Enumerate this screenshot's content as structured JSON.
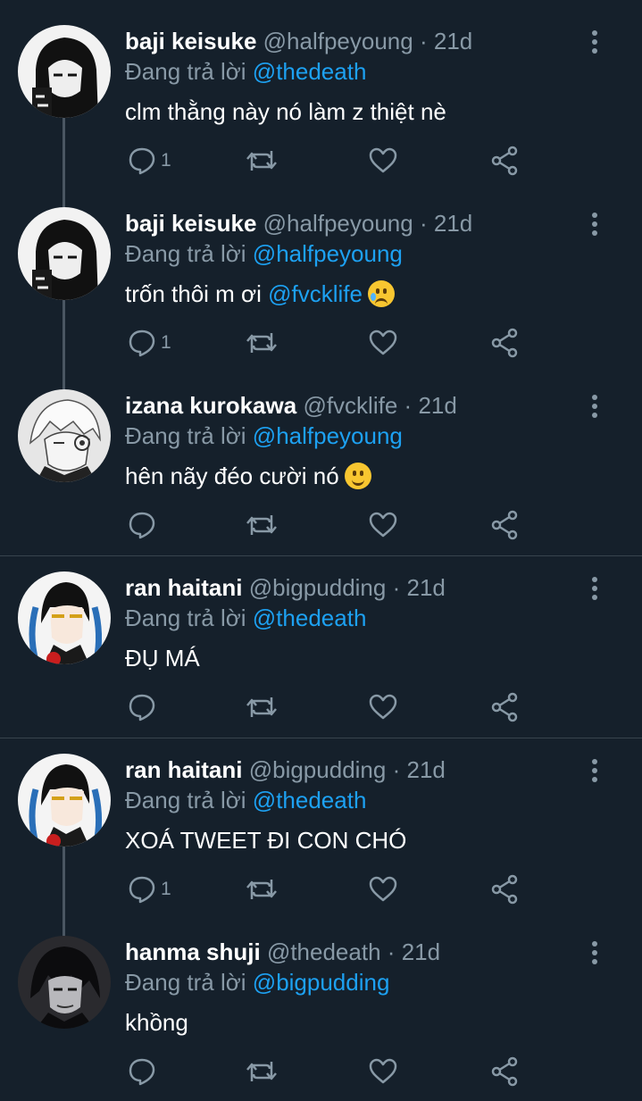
{
  "reply_prefix": "Đang trả lời",
  "separator": "·",
  "tweets": [
    {
      "name": "baji keisuke",
      "handle": "@halfpeyoung",
      "time": "21d",
      "reply_to": "@thedeath",
      "text": "clm thằng này nó làm z thiệt nè",
      "mention": "",
      "emoji": "",
      "reply_count": "1",
      "avatar": "baji-avatar"
    },
    {
      "name": "baji keisuke",
      "handle": "@halfpeyoung",
      "time": "21d",
      "reply_to": "@halfpeyoung",
      "text": "trốn thôi m ơi ",
      "mention": "@fvcklife",
      "emoji": "crying-face",
      "reply_count": "1",
      "avatar": "baji-avatar"
    },
    {
      "name": "izana kurokawa",
      "handle": "@fvcklife",
      "time": "21d",
      "reply_to": "@halfpeyoung",
      "text": "hên nãy đéo cười nó",
      "mention": "",
      "emoji": "slightly-smiling-face",
      "reply_count": "",
      "avatar": "izana-avatar"
    },
    {
      "name": "ran haitani",
      "handle": "@bigpudding",
      "time": "21d",
      "reply_to": "@thedeath",
      "text": "ĐỤ MÁ",
      "mention": "",
      "emoji": "",
      "reply_count": "",
      "avatar": "ran-avatar"
    },
    {
      "name": "ran haitani",
      "handle": "@bigpudding",
      "time": "21d",
      "reply_to": "@thedeath",
      "text": "XOÁ TWEET ĐI CON CHÓ",
      "mention": "",
      "emoji": "",
      "reply_count": "1",
      "avatar": "ran-avatar"
    },
    {
      "name": "hanma shuji",
      "handle": "@thedeath",
      "time": "21d",
      "reply_to": "@bigpudding",
      "text": "khồng",
      "mention": "",
      "emoji": "",
      "reply_count": "",
      "avatar": "hanma-avatar"
    }
  ],
  "colors": {
    "background": "#15202b",
    "muted": "#8899a6",
    "accent": "#1da1f2",
    "divider": "#38444d",
    "thread_line": "#4a5662"
  }
}
